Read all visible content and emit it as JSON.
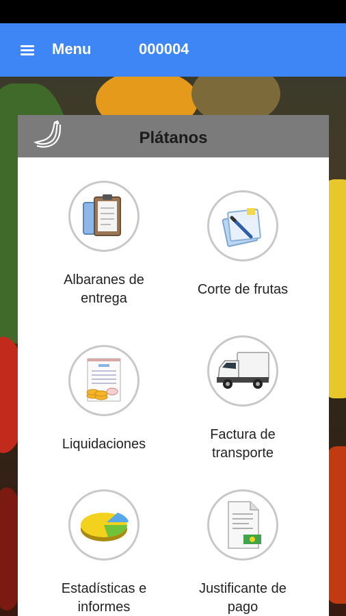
{
  "app_bar": {
    "menu_label": "Menu",
    "code": "000004",
    "color": "#3e86f5"
  },
  "card": {
    "title": "Plátanos",
    "header_icon": "banana-icon",
    "tiles": [
      {
        "label": "Albaranes de\nentrega",
        "icon": "clipboard-icon"
      },
      {
        "label": "Corte de frutas",
        "icon": "document-pen-icon"
      },
      {
        "label": "Liquidaciones",
        "icon": "invoice-coins-icon"
      },
      {
        "label": "Factura de\ntransporte",
        "icon": "van-icon"
      },
      {
        "label": "Estadísticas e\ninformes",
        "icon": "pie-chart-icon"
      },
      {
        "label": "Justificante de\npago",
        "icon": "receipt-icon"
      }
    ]
  }
}
